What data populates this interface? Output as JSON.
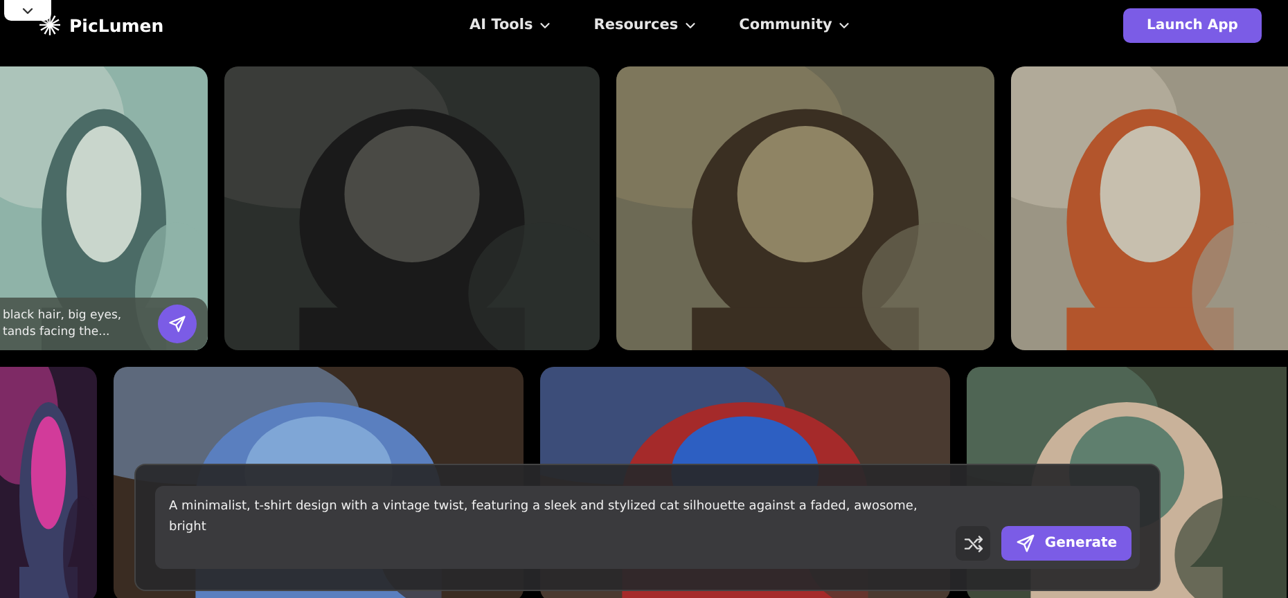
{
  "header": {
    "logo": "PicLumen",
    "menu": [
      {
        "label": "AI Tools"
      },
      {
        "label": "Resources"
      },
      {
        "label": "Community"
      }
    ],
    "action": "Launch App"
  },
  "gallery": {
    "rows": [
      {
        "cards": [
          {
            "kind": "picture",
            "caption": [
              "black hair, big eyes,",
              "tands facing the..."
            ]
          },
          {
            "kind": "picture"
          },
          {
            "kind": "picture"
          },
          {
            "kind": "picture"
          }
        ]
      },
      {
        "cards": [
          {
            "kind": "picture"
          },
          {
            "kind": "picture"
          },
          {
            "kind": "picture"
          },
          {
            "kind": "picture"
          }
        ]
      }
    ]
  },
  "prompt": {
    "value": "A minimalist, t-shirt design with a vintage twist, featuring a sleek and stylized cat silhouette against a faded, awosome, bright",
    "button": "Generate"
  }
}
